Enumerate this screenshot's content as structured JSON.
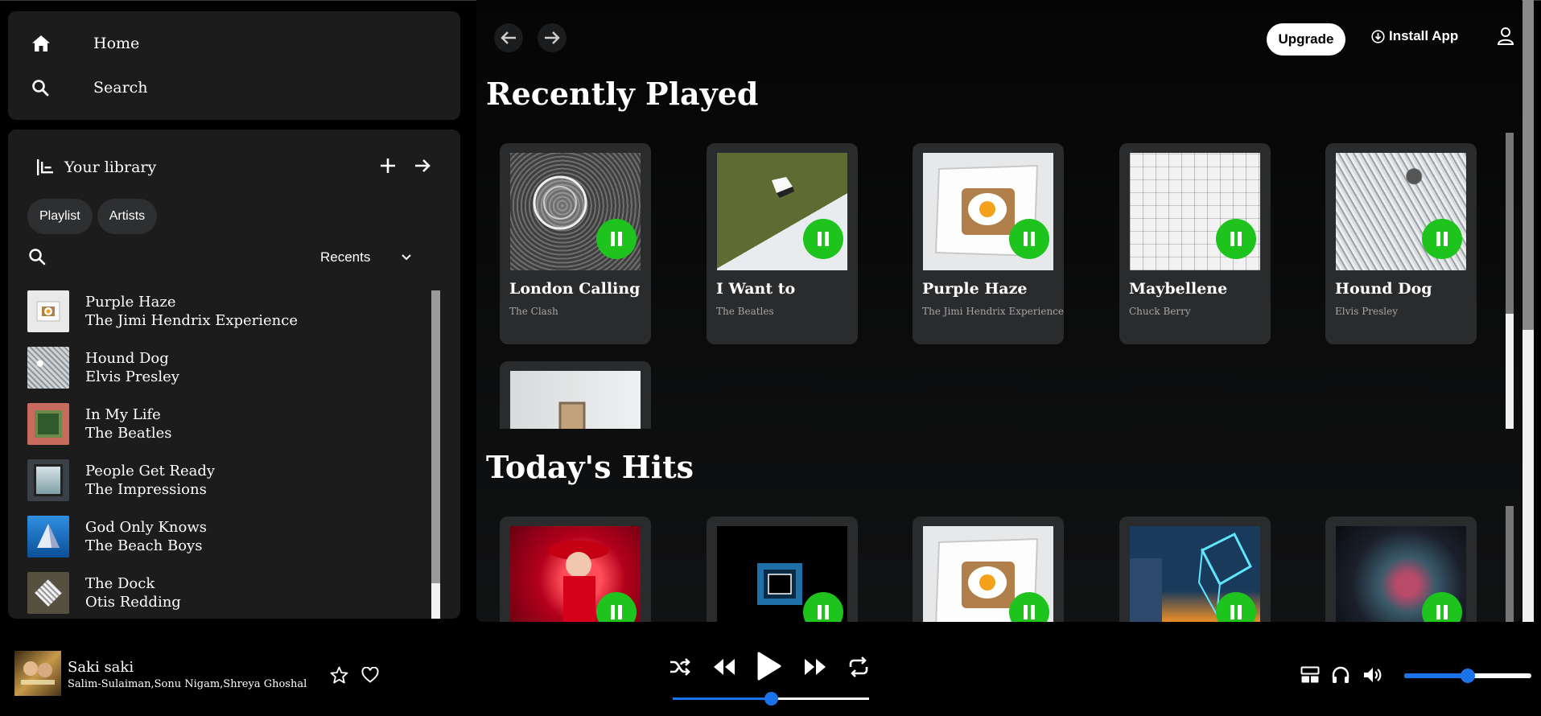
{
  "sidebar": {
    "nav": [
      {
        "label": "Home",
        "icon": "home-icon"
      },
      {
        "label": "Search",
        "icon": "search-icon"
      }
    ],
    "library": {
      "title": "Your library",
      "filters": [
        "Playlist",
        "Artists"
      ],
      "sort_label": "Recents",
      "items": [
        {
          "title": "Purple Haze",
          "artist": "The Jimi Hendrix Experience"
        },
        {
          "title": "Hound Dog",
          "artist": "Elvis Presley"
        },
        {
          "title": "In My Life",
          "artist": "The Beatles"
        },
        {
          "title": "People Get Ready",
          "artist": "The Impressions"
        },
        {
          "title": "God Only Knows",
          "artist": "The Beach Boys"
        },
        {
          "title": "The Dock",
          "artist": "Otis Redding"
        }
      ]
    }
  },
  "header": {
    "upgrade_label": "Upgrade",
    "install_label": "Install App"
  },
  "sections": [
    {
      "title": "Recently Played",
      "cards": [
        {
          "title": "London Calling",
          "artist": "The Clash"
        },
        {
          "title": "I Want to",
          "artist": "The Beatles"
        },
        {
          "title": "Purple Haze",
          "artist": "The Jimi Hendrix Experience"
        },
        {
          "title": "Maybellene",
          "artist": "Chuck Berry"
        },
        {
          "title": "Hound Dog",
          "artist": "Elvis Presley"
        },
        {
          "title": "",
          "artist": ""
        }
      ]
    },
    {
      "title": "Today's Hits",
      "cards": [
        {
          "title": "",
          "artist": ""
        },
        {
          "title": "",
          "artist": ""
        },
        {
          "title": "",
          "artist": ""
        },
        {
          "title": "",
          "artist": ""
        },
        {
          "title": "",
          "artist": ""
        }
      ]
    }
  ],
  "player": {
    "title": "Saki saki",
    "artist": "Salim-Sulaiman,Sonu Nigam,Shreya Ghoshal",
    "progress": 0.5,
    "volume": 0.5
  },
  "colors": {
    "accent": "#1a73e8",
    "play_green": "#1ec31e",
    "panel": "#1c1c1d",
    "card": "#2a2b2d"
  }
}
